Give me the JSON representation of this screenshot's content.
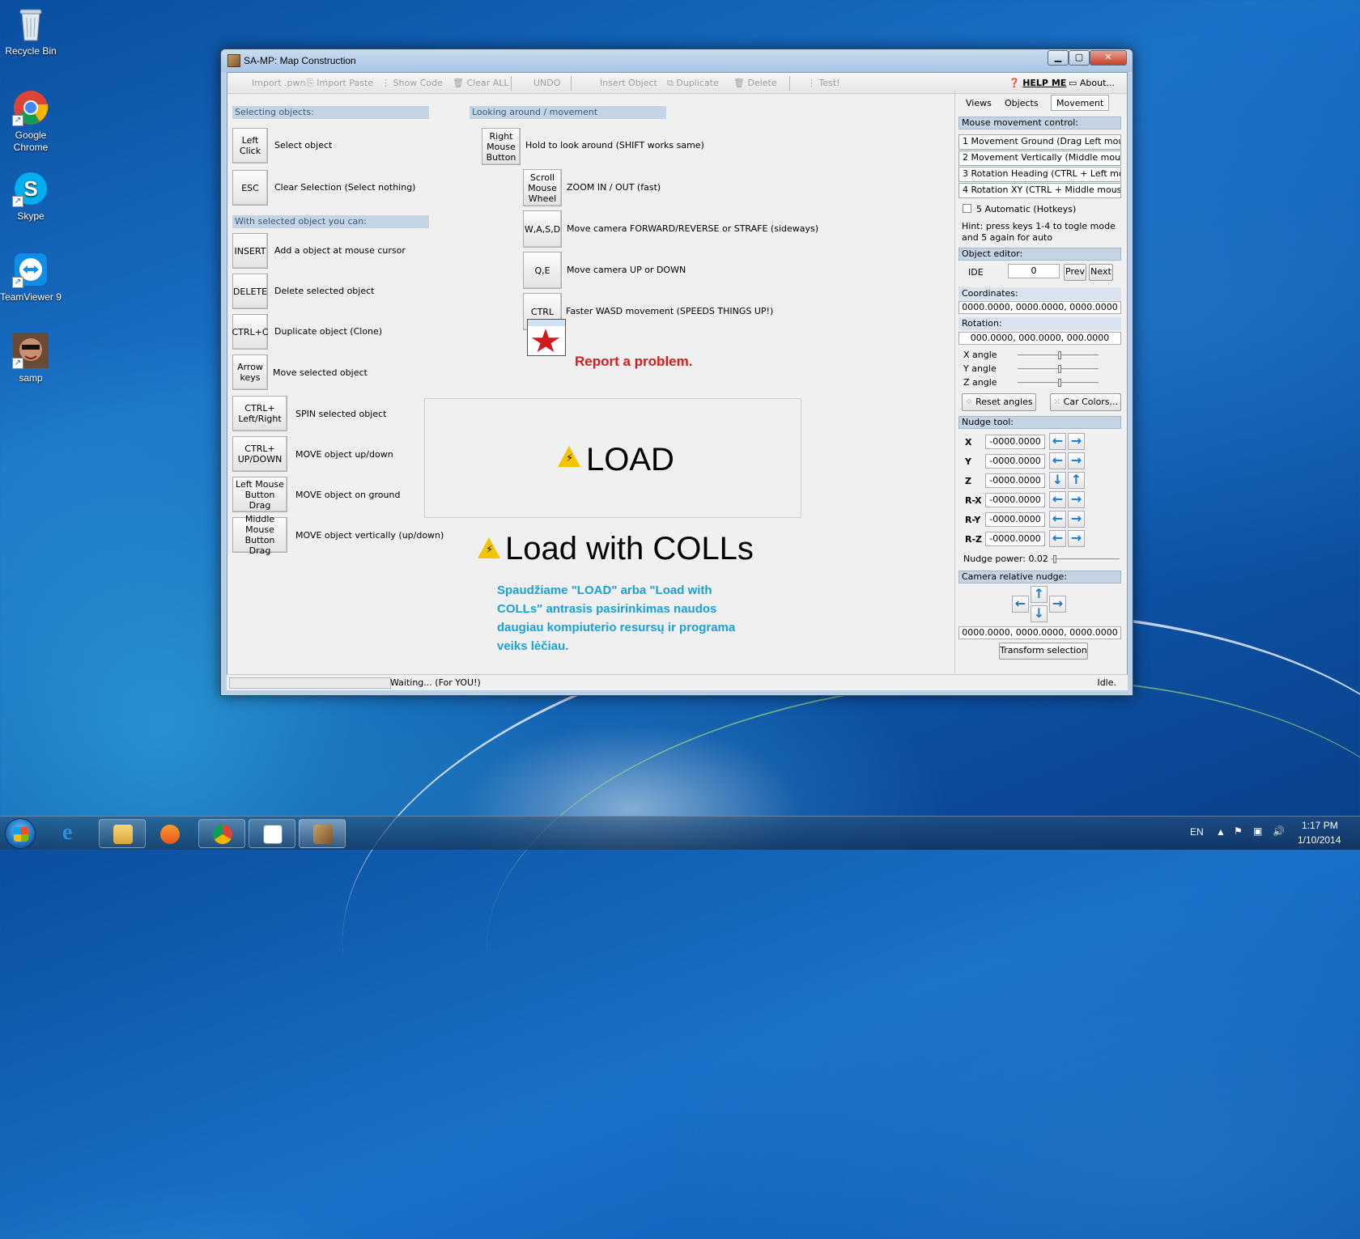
{
  "desktop": {
    "icons": [
      {
        "label": "Recycle Bin"
      },
      {
        "label": "Google Chrome"
      },
      {
        "label": "Skype"
      },
      {
        "label": "TeamViewer 9"
      },
      {
        "label": "samp"
      }
    ]
  },
  "window": {
    "title": "SA-MP: Map Construction",
    "toolbar": {
      "import_pwn": "Import .pwn",
      "import_paste": "Import Paste",
      "show_code": "Show Code",
      "clear_all": "Clear ALL",
      "undo": "UNDO",
      "insert_object": "Insert Object",
      "duplicate": "Duplicate",
      "delete": "Delete",
      "test": "Test!",
      "help_me": "HELP ME",
      "about": "About..."
    },
    "help": {
      "selecting_header": "Selecting objects:",
      "selecting": [
        {
          "key": "Left Click",
          "desc": "Select object"
        },
        {
          "key": "ESC",
          "desc": "Clear Selection (Select nothing)"
        }
      ],
      "selected_header": "With selected object you can:",
      "selected": [
        {
          "key": "INSERT",
          "desc": "Add a object at mouse cursor"
        },
        {
          "key": "DELETE",
          "desc": "Delete selected object"
        },
        {
          "key": "CTRL+C",
          "desc": "Duplicate object (Clone)"
        },
        {
          "key": "Arrow keys",
          "desc": "Move selected object"
        },
        {
          "key": "CTRL+ Left/Right",
          "desc": "SPIN selected object"
        },
        {
          "key": "CTRL+ UP/DOWN",
          "desc": "MOVE object up/down"
        },
        {
          "key": "Left Mouse Button Drag",
          "desc": "MOVE object on ground"
        },
        {
          "key": "Middle Mouse Button Drag",
          "desc": "MOVE object vertically (up/down)"
        }
      ],
      "looking_header": "Looking around / movement",
      "looking": [
        {
          "key": "Right Mouse Button",
          "desc": "Hold to look around (SHIFT works same)"
        },
        {
          "key": "Scroll Mouse Wheel",
          "desc": "ZOOM IN / OUT (fast)"
        },
        {
          "key": "W,A,S,D",
          "desc": "Move camera FORWARD/REVERSE or STRAFE (sideways)"
        },
        {
          "key": "Q,E",
          "desc": "Move camera UP or DOWN"
        },
        {
          "key": "CTRL",
          "desc": "Faster WASD movement (SPEEDS THINGS UP!)"
        }
      ],
      "report": "Report a problem.",
      "load": "LOAD",
      "load_colls": "Load with COLLs",
      "note": "Spaudžiame \"LOAD\" arba \"Load with COLLs\" antrasis pasirinkimas naudos daugiau kompiuterio resursų ir programa veiks lėčiau."
    },
    "panel": {
      "tabs": [
        "Views",
        "Objects",
        "Movement"
      ],
      "active_tab": "Movement",
      "mouse_header": "Mouse movement control:",
      "modes": [
        "1 Movement Ground (Drag Left mouse)",
        "2 Movement Vertically (Middle mouse)",
        "3 Rotation Heading (CTRL + Left mouse)",
        "4 Rotation XY (CTRL + Middle mouse)"
      ],
      "automatic": "5 Automatic (Hotkeys)",
      "hint": "Hint: press keys 1-4 to togle mode and 5 again for auto",
      "object_editor_header": "Object editor:",
      "ide_label": "IDE",
      "ide_value": "0",
      "prev": "Prev",
      "next": "Next",
      "coordinates_label": "Coordinates:",
      "coordinates_value": "0000.0000, 0000.0000, 0000.0000",
      "rotation_label": "Rotation:",
      "rotation_value": "000.0000, 000.0000, 000.0000",
      "angles": [
        "X angle",
        "Y angle",
        "Z angle"
      ],
      "reset_angles": "Reset angles",
      "car_colors": "Car Colors...",
      "nudge_header": "Nudge tool:",
      "nudge": [
        {
          "label": "X",
          "value": "-0000.0000"
        },
        {
          "label": "Y",
          "value": "-0000.0000"
        },
        {
          "label": "Z",
          "value": "-0000.0000"
        },
        {
          "label": "R-X",
          "value": "-0000.0000"
        },
        {
          "label": "R-Y",
          "value": "-0000.0000"
        },
        {
          "label": "R-Z",
          "value": "-0000.0000"
        }
      ],
      "nudge_power": "Nudge power: 0.02",
      "camera_nudge_header": "Camera relative nudge:",
      "camera_value": "0000.0000, 0000.0000, 0000.0000",
      "transform": "Transform selection"
    },
    "status": {
      "waiting": "Waiting... (For YOU!)",
      "idle": "Idle."
    }
  },
  "taskbar": {
    "lang": "EN",
    "time": "1:17 PM",
    "date": "1/10/2014"
  }
}
